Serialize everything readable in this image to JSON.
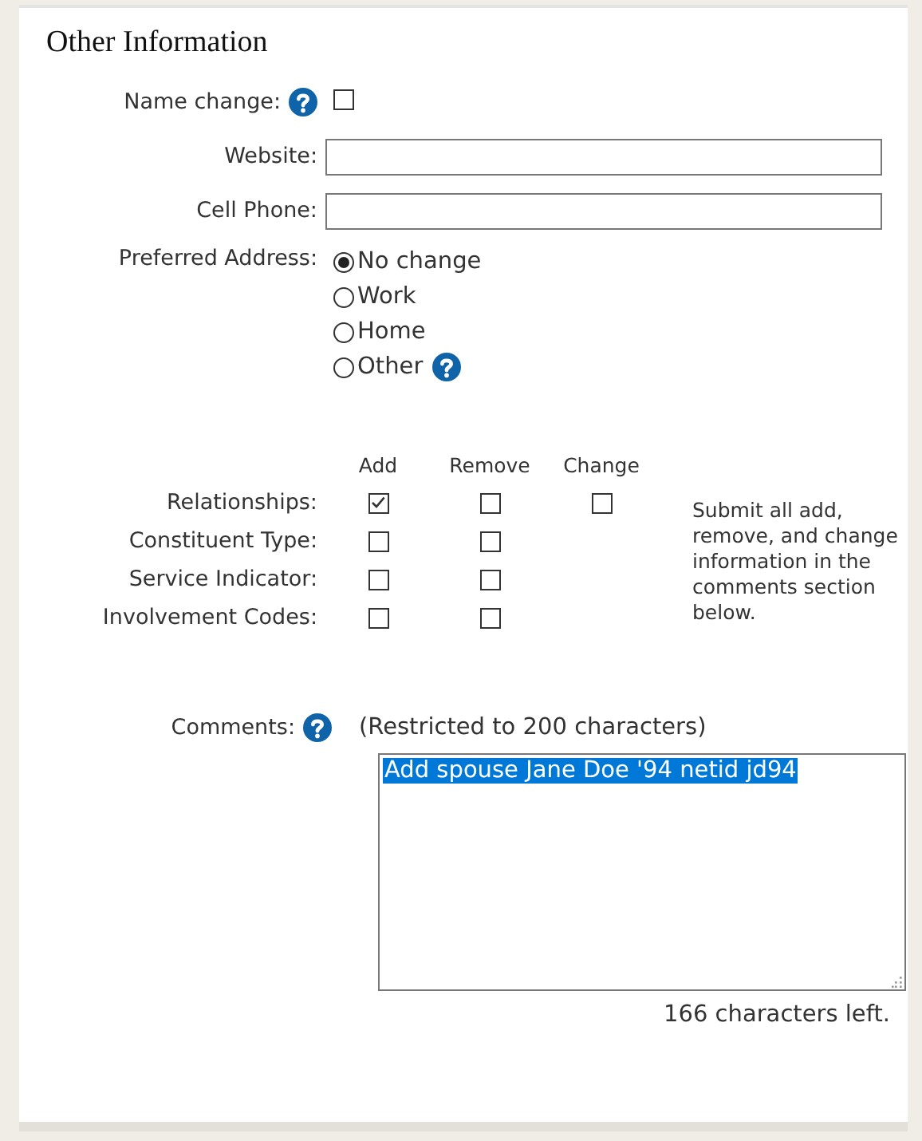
{
  "section": {
    "title": "Other Information"
  },
  "name_change": {
    "label": "Name change:",
    "checked": false
  },
  "text_fields": [
    {
      "label": "Website:"
    },
    {
      "label": "Cell Phone:"
    }
  ],
  "preferred_address": {
    "label": "Preferred Address:",
    "options": [
      {
        "label": "No change",
        "selected": true,
        "help": false
      },
      {
        "label": "Work",
        "selected": false,
        "help": false
      },
      {
        "label": "Home",
        "selected": false,
        "help": false
      },
      {
        "label": "Other",
        "selected": false,
        "help": true
      }
    ]
  },
  "change_table": {
    "columns": [
      "Add",
      "Remove",
      "Change"
    ],
    "rows": [
      {
        "label": "Relationships:",
        "boxes": [
          {
            "checked": true
          },
          {
            "checked": false
          },
          {
            "checked": false
          }
        ]
      },
      {
        "label": "Constituent Type:",
        "boxes": [
          {
            "checked": false
          },
          {
            "checked": false
          }
        ]
      },
      {
        "label": "Service Indicator:",
        "boxes": [
          {
            "checked": false
          },
          {
            "checked": false
          }
        ]
      },
      {
        "label": "Involvement Codes:",
        "boxes": [
          {
            "checked": false
          },
          {
            "checked": false
          }
        ]
      }
    ],
    "note": "Submit all add, remove, and change information in the comments section below."
  },
  "comments": {
    "label": "Comments:",
    "hint": "(Restricted to 200 characters)",
    "value": "Add spouse Jane Doe '94 netid jd94",
    "value_selected": true,
    "counter": "166 characters left."
  }
}
